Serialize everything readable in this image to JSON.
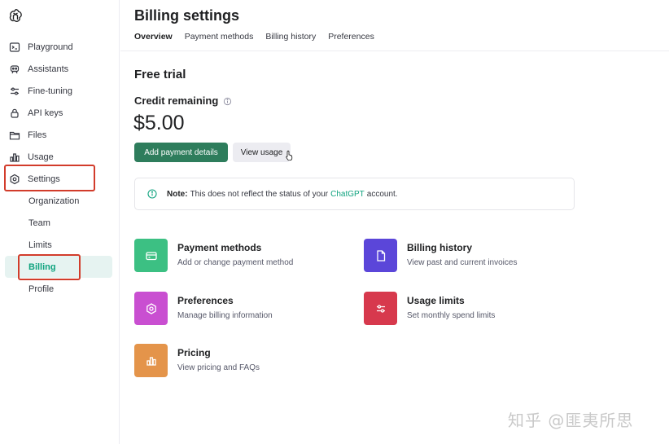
{
  "app": {
    "logo_icon": "openai-logo-icon"
  },
  "sidebar": {
    "items": [
      {
        "label": "Playground",
        "icon": "terminal-icon"
      },
      {
        "label": "Assistants",
        "icon": "robot-icon"
      },
      {
        "label": "Fine-tuning",
        "icon": "sliders-icon"
      },
      {
        "label": "API keys",
        "icon": "lock-icon"
      },
      {
        "label": "Files",
        "icon": "folder-icon"
      },
      {
        "label": "Usage",
        "icon": "bar-chart-icon"
      },
      {
        "label": "Settings",
        "icon": "gear-icon"
      }
    ],
    "sub_items": [
      "Organization",
      "Team",
      "Limits",
      "Billing",
      "Profile"
    ],
    "active_sub_item": "Billing"
  },
  "header": {
    "title": "Billing settings",
    "tabs": [
      "Overview",
      "Payment methods",
      "Billing history",
      "Preferences"
    ],
    "active_tab": "Overview"
  },
  "plan": {
    "title": "Free trial",
    "credit_label": "Credit remaining",
    "credit_amount": "$5.00",
    "primary_button": "Add payment details",
    "secondary_button": "View usage"
  },
  "note": {
    "prefix": "Note:",
    "text_before": "This does not reflect the status of your",
    "link": "ChatGPT",
    "text_after": "account."
  },
  "cards": [
    {
      "title": "Payment methods",
      "desc": "Add or change payment method",
      "color": "#3cc083",
      "icon": "credit-card-icon"
    },
    {
      "title": "Billing history",
      "desc": "View past and current invoices",
      "color": "#5b46d9",
      "icon": "document-icon"
    },
    {
      "title": "Preferences",
      "desc": "Manage billing information",
      "color": "#c94fd1",
      "icon": "settings-hex-icon"
    },
    {
      "title": "Usage limits",
      "desc": "Set monthly spend limits",
      "color": "#d7394d",
      "icon": "sliders-icon"
    },
    {
      "title": "Pricing",
      "desc": "View pricing and FAQs",
      "color": "#e4944a",
      "icon": "bar-chart-icon"
    }
  ],
  "colors": {
    "accent": "#10a37f",
    "primary_button": "#2e7d5c",
    "highlight_box": "#d23c2b"
  },
  "watermark": "知乎 @匪夷所思"
}
